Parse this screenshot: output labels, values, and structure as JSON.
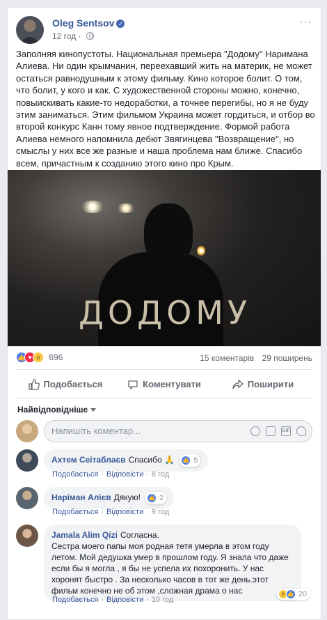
{
  "post": {
    "author": "Oleg Sentsov",
    "time": "12 год",
    "body": "Заполняя кинопустоты. Национальная премьера \"Додому\" Наримана Алиева. Ни один крымчанин, переехавший жить на материк, не может остаться равнодушным к этому фильму. Кино которое болит. О том, что болит, у кого и как. С художественной стороны можно, конечно, повыискивать какие-то недоработки, а точнее перегибы, но я не буду этим заниматься. Этим фильмом Украина может гордиться, и отбор во второй конкурс Канн тому явное подтверждение. Формой работа Алиева немного напомнила дебют Звягинцева \"Возвращение\", но смыслы у них все же разные и наша проблема нам ближе. Спасибо всем, причастным к созданию этого кино про Крым.",
    "image_title": "ДОДОМУ",
    "reaction_count": "696",
    "comments_count": "15 коментарів",
    "shares_count": "29 поширень"
  },
  "actions": {
    "like": "Подобається",
    "comment": "Коментувати",
    "share": "Поширити"
  },
  "comments_section": {
    "sort_label": "Найвідповідніше",
    "input_placeholder": "Напишіть коментар..."
  },
  "comments": [
    {
      "name": "Ахтем Сеітаблаєв",
      "text": "Спасибо 🙏",
      "reactions": "5",
      "reply_label": "Подобається",
      "answer_label": "Відповісти",
      "time": "8 год"
    },
    {
      "name": "Наріман Алієв",
      "text": "Дякую!",
      "reactions": "2",
      "reply_label": "Подобається",
      "answer_label": "Відповісти",
      "time": "9 год"
    },
    {
      "name": "Jamala Alim Qizi",
      "text": "Согласна.\nСестра моего папы моя родная тетя умерла в этом году летом. Мой дедушка умер в прошлом году. Я знала что даже если бы я могла , я бы не успела их похоронить. У нас хоронят быстро . За несколько часов в тот же день.этот фильм конечно не об этом ,сложная драма о нас",
      "reactions": "20",
      "reply_label": "Подобається",
      "answer_label": "Відповісти",
      "time": "10 год"
    }
  ],
  "colors": {
    "link": "#385898",
    "like": "#4d7ef0",
    "love": "#f0284a",
    "wow": "#f7c845"
  }
}
